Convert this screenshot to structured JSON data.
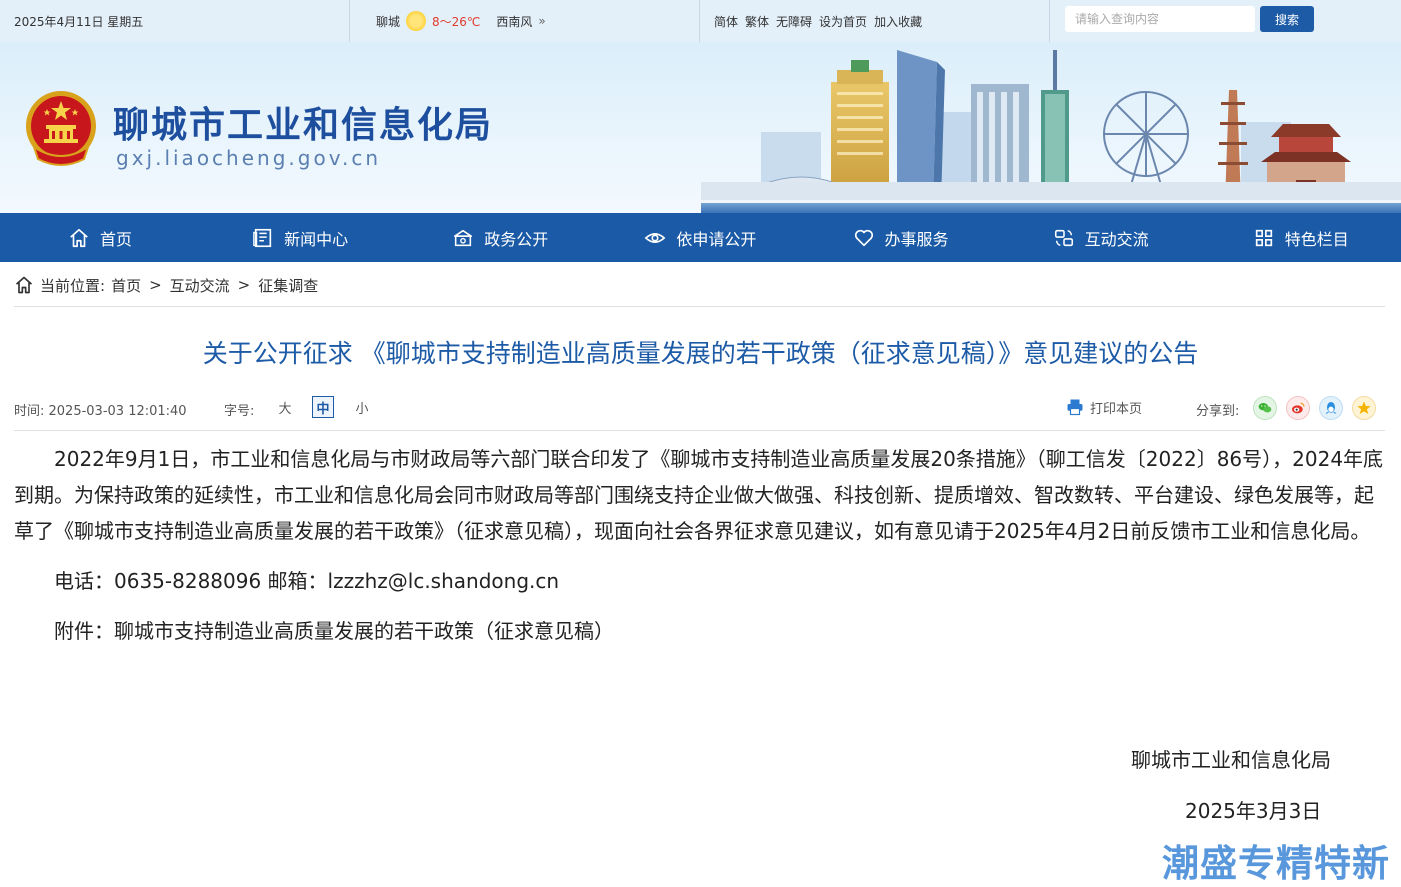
{
  "topbar": {
    "date": "2025年4月11日 星期五",
    "city": "聊城",
    "temp": "8～26℃",
    "wind": "西南风",
    "links": [
      "简体",
      "繁体",
      "无障碍",
      "设为首页",
      "加入收藏"
    ],
    "search_placeholder": "请输入查询内容",
    "search_label": "搜索"
  },
  "banner": {
    "title": "聊城市工业和信息化局",
    "domain": "gxj.liaocheng.gov.cn"
  },
  "nav": {
    "items": [
      {
        "label": "首页",
        "icon": "home-icon"
      },
      {
        "label": "新闻中心",
        "icon": "news-icon"
      },
      {
        "label": "政务公开",
        "icon": "gov-icon"
      },
      {
        "label": "依申请公开",
        "icon": "eye-icon"
      },
      {
        "label": "办事服务",
        "icon": "heart-icon"
      },
      {
        "label": "互动交流",
        "icon": "interaction-icon"
      },
      {
        "label": "特色栏目",
        "icon": "grid-icon"
      }
    ]
  },
  "breadcrumb": {
    "label": "当前位置:",
    "items": [
      "首页",
      "互动交流",
      "征集调查"
    ],
    "sep": ">"
  },
  "article": {
    "title": "关于公开征求 《聊城市支持制造业高质量发展的若干政策（征求意见稿）》意见建议的公告",
    "time": "时间:  2025-03-03 12:01:40",
    "font_size_label": "字号:",
    "font_sizes": [
      "大",
      "中",
      "小"
    ],
    "print_label": "打印本页",
    "share_label": "分享到:",
    "paragraph1": "2022年9月1日，市工业和信息化局与市财政局等六部门联合印发了《聊城市支持制造业高质量发展20条措施》（聊工信发〔2022〕86号），2024年底到期。为保持政策的延续性，市工业和信息化局会同市财政局等部门围绕支持企业做大做强、科技创新、提质增效、智改数转、平台建设、绿色发展等，起草了《聊城市支持制造业高质量发展的若干政策》（征求意见稿），现面向社会各界征求意见建议，如有意见请于2025年4月2日前反馈市工业和信息化局。",
    "contact": "电话：0635-8288096  邮箱：lzzzhz@lc.shandong.cn",
    "attachment": "附件：聊城市支持制造业高质量发展的若干政策（征求意见稿）",
    "sign_org": "聊城市工业和信息化局",
    "sign_date": "2025年3月3日"
  },
  "watermark": "潮盛专精特新",
  "colors": {
    "primary": "#1a5aa6",
    "title": "#1d5ba7",
    "topbar_bg": "#e3eff9"
  }
}
